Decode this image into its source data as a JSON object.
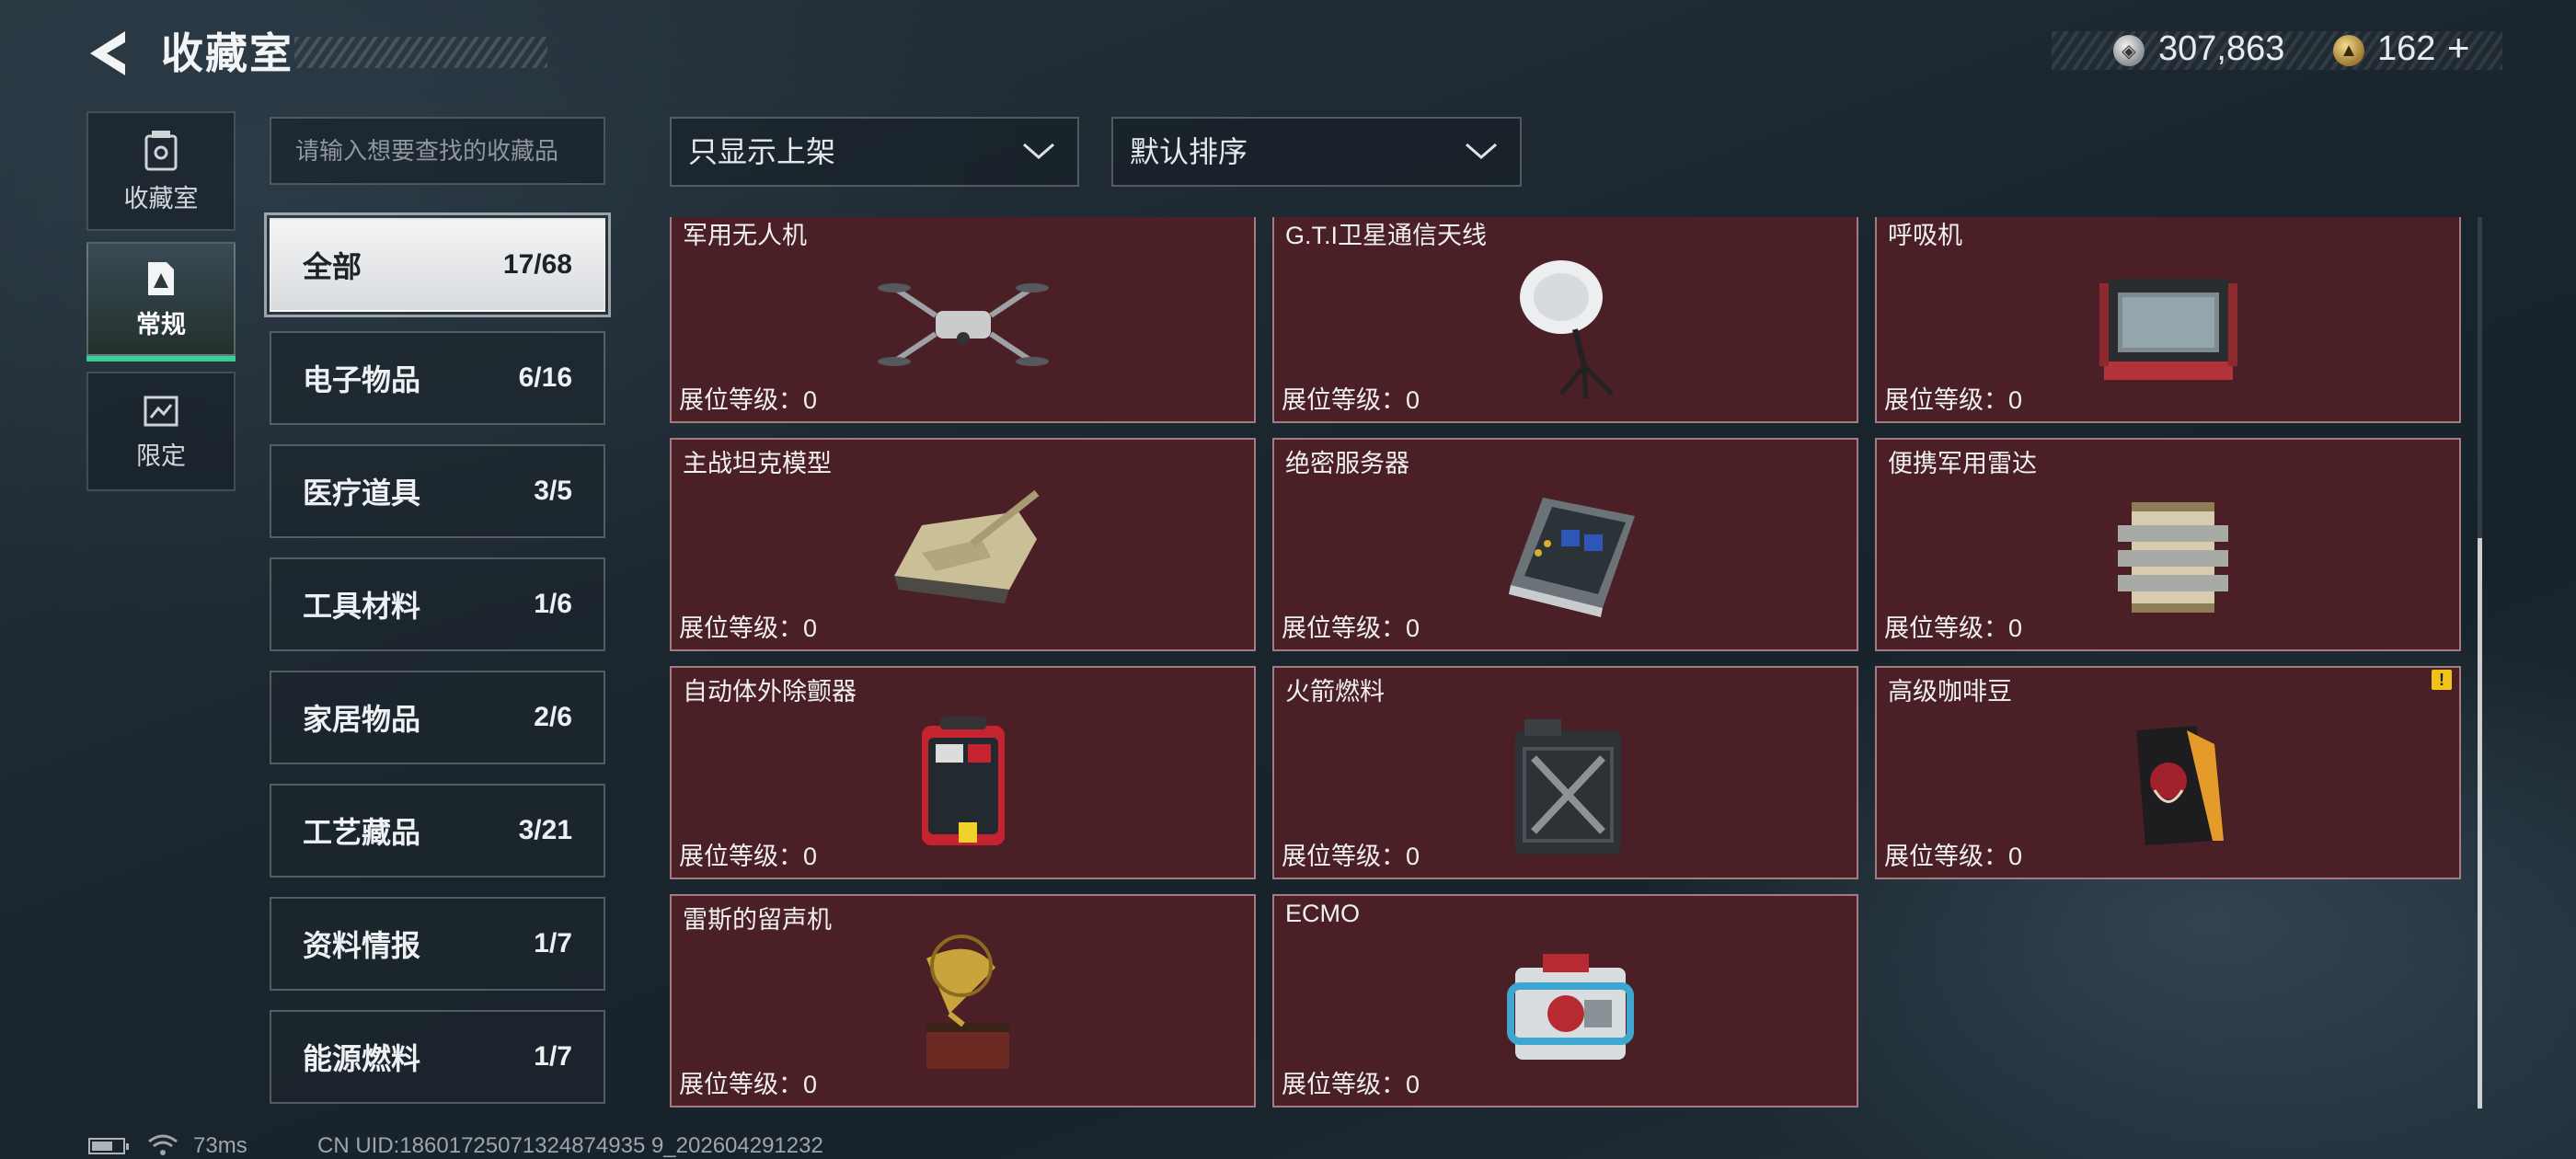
{
  "header": {
    "title": "收藏室",
    "currency_silver": "307,863",
    "currency_gold": "162",
    "currency_gold_add": "+"
  },
  "side_tabs": [
    {
      "label": "收藏室",
      "icon": "collection-vault-icon",
      "active": false
    },
    {
      "label": "常规",
      "icon": "regular-collection-icon",
      "active": true
    },
    {
      "label": "限定",
      "icon": "limited-collection-icon",
      "active": false
    }
  ],
  "search": {
    "placeholder": "请输入想要查找的收藏品"
  },
  "filters": {
    "display_filter": "只显示上架",
    "sort_order": "默认排序"
  },
  "categories": [
    {
      "name": "全部",
      "count": "17/68",
      "active": true
    },
    {
      "name": "电子物品",
      "count": "6/16",
      "active": false
    },
    {
      "name": "医疗道具",
      "count": "3/5",
      "active": false
    },
    {
      "name": "工具材料",
      "count": "1/6",
      "active": false
    },
    {
      "name": "家居物品",
      "count": "2/6",
      "active": false
    },
    {
      "name": "工艺藏品",
      "count": "3/21",
      "active": false
    },
    {
      "name": "资料情报",
      "count": "1/7",
      "active": false
    },
    {
      "name": "能源燃料",
      "count": "1/7",
      "active": false
    }
  ],
  "items": [
    {
      "name": "军用无人机",
      "level": "展位等级：0",
      "icon": "drone-icon"
    },
    {
      "name": "G.T.I卫星通信天线",
      "level": "展位等级：0",
      "icon": "satellite-dish-icon"
    },
    {
      "name": "呼吸机",
      "level": "展位等级：0",
      "icon": "ventilator-icon"
    },
    {
      "name": "主战坦克模型",
      "level": "展位等级：0",
      "icon": "tank-model-icon"
    },
    {
      "name": "绝密服务器",
      "level": "展位等级：0",
      "icon": "server-icon"
    },
    {
      "name": "便携军用雷达",
      "level": "展位等级：0",
      "icon": "radar-icon"
    },
    {
      "name": "自动体外除颤器",
      "level": "展位等级：0",
      "icon": "defibrillator-icon"
    },
    {
      "name": "火箭燃料",
      "level": "展位等级：0",
      "icon": "fuel-canister-icon"
    },
    {
      "name": "高级咖啡豆",
      "level": "展位等级：0",
      "icon": "coffee-bag-icon",
      "warning": "!"
    },
    {
      "name": "雷斯的留声机",
      "level": "展位等级：0",
      "icon": "gramophone-icon"
    },
    {
      "name": "ECMO",
      "level": "展位等级：0",
      "icon": "ecmo-machine-icon"
    }
  ],
  "footer": {
    "ping": "73ms",
    "uid": "CN UID:18601725071324874935 9_202604291232"
  },
  "colors": {
    "card_bg": "#4a1f25",
    "active_tab_accent": "#36d18e",
    "warning": "#f0c21a"
  }
}
